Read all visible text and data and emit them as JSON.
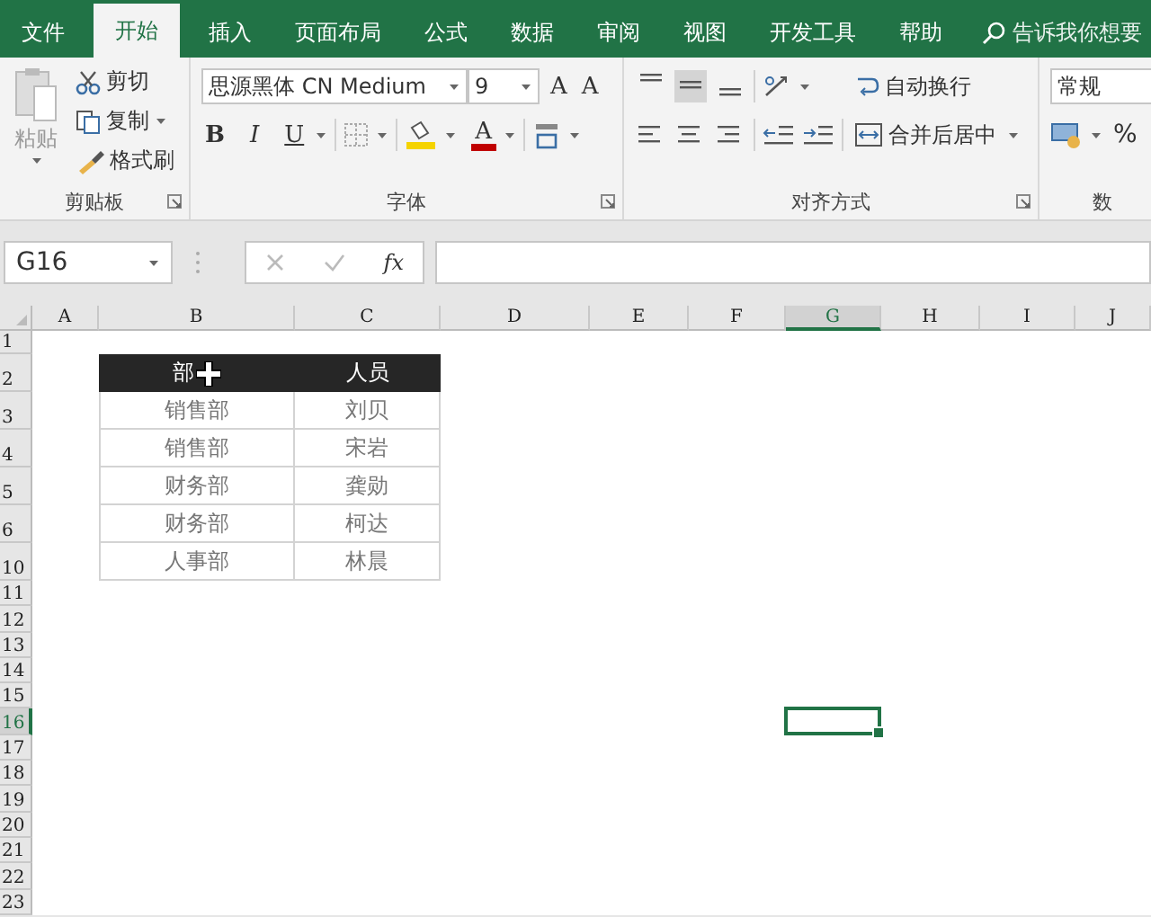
{
  "ribbon_tabs": [
    {
      "label": "文件",
      "selected": false
    },
    {
      "label": "开始",
      "selected": true
    },
    {
      "label": "插入",
      "selected": false
    },
    {
      "label": "页面布局",
      "selected": false
    },
    {
      "label": "公式",
      "selected": false
    },
    {
      "label": "数据",
      "selected": false
    },
    {
      "label": "审阅",
      "selected": false
    },
    {
      "label": "视图",
      "selected": false
    },
    {
      "label": "开发工具",
      "selected": false
    },
    {
      "label": "帮助",
      "selected": false
    }
  ],
  "tell_me": "告诉我你想要",
  "clipboard": {
    "paste": "粘贴",
    "cut": "剪切",
    "copy": "复制",
    "format_painter": "格式刷",
    "group": "剪贴板"
  },
  "font": {
    "name": "思源黑体 CN Medium",
    "size": "9",
    "grow": "A",
    "shrink": "A",
    "bold": "B",
    "italic": "I",
    "underline": "U",
    "font_color": "A",
    "group": "字体"
  },
  "alignment": {
    "vertical": [
      {
        "selected": false
      },
      {
        "selected": true
      },
      {
        "selected": false
      }
    ],
    "wrap": "自动换行",
    "merge": "合并后居中",
    "group": "对齐方式"
  },
  "number": {
    "format": "常规",
    "percent": "%",
    "group": "数"
  },
  "name_box": "G16",
  "fx": "fx",
  "columns": [
    {
      "label": "A",
      "selected": false
    },
    {
      "label": "B",
      "selected": false
    },
    {
      "label": "C",
      "selected": false
    },
    {
      "label": "D",
      "selected": false
    },
    {
      "label": "E",
      "selected": false
    },
    {
      "label": "F",
      "selected": false
    },
    {
      "label": "G",
      "selected": true
    },
    {
      "label": "H",
      "selected": false
    },
    {
      "label": "I",
      "selected": false
    },
    {
      "label": "J",
      "selected": false
    }
  ],
  "rows": [
    {
      "label": "1",
      "selected": false
    },
    {
      "label": "2",
      "selected": false
    },
    {
      "label": "3",
      "selected": false
    },
    {
      "label": "4",
      "selected": false
    },
    {
      "label": "5",
      "selected": false
    },
    {
      "label": "6",
      "selected": false
    },
    {
      "label": "10",
      "selected": false
    },
    {
      "label": "11",
      "selected": false
    },
    {
      "label": "12",
      "selected": false
    },
    {
      "label": "13",
      "selected": false
    },
    {
      "label": "14",
      "selected": false
    },
    {
      "label": "15",
      "selected": false
    },
    {
      "label": "16",
      "selected": true
    },
    {
      "label": "17",
      "selected": false
    },
    {
      "label": "18",
      "selected": false
    },
    {
      "label": "19",
      "selected": false
    },
    {
      "label": "20",
      "selected": false
    },
    {
      "label": "21",
      "selected": false
    },
    {
      "label": "22",
      "selected": false
    },
    {
      "label": "23",
      "selected": false
    }
  ],
  "table": {
    "header": [
      "部",
      "人员"
    ],
    "rows": [
      [
        "销售部",
        "刘贝"
      ],
      [
        "销售部",
        "宋岩"
      ],
      [
        "财务部",
        "龚勋"
      ],
      [
        "财务部",
        "柯达"
      ],
      [
        "人事部",
        "林晨"
      ]
    ]
  }
}
